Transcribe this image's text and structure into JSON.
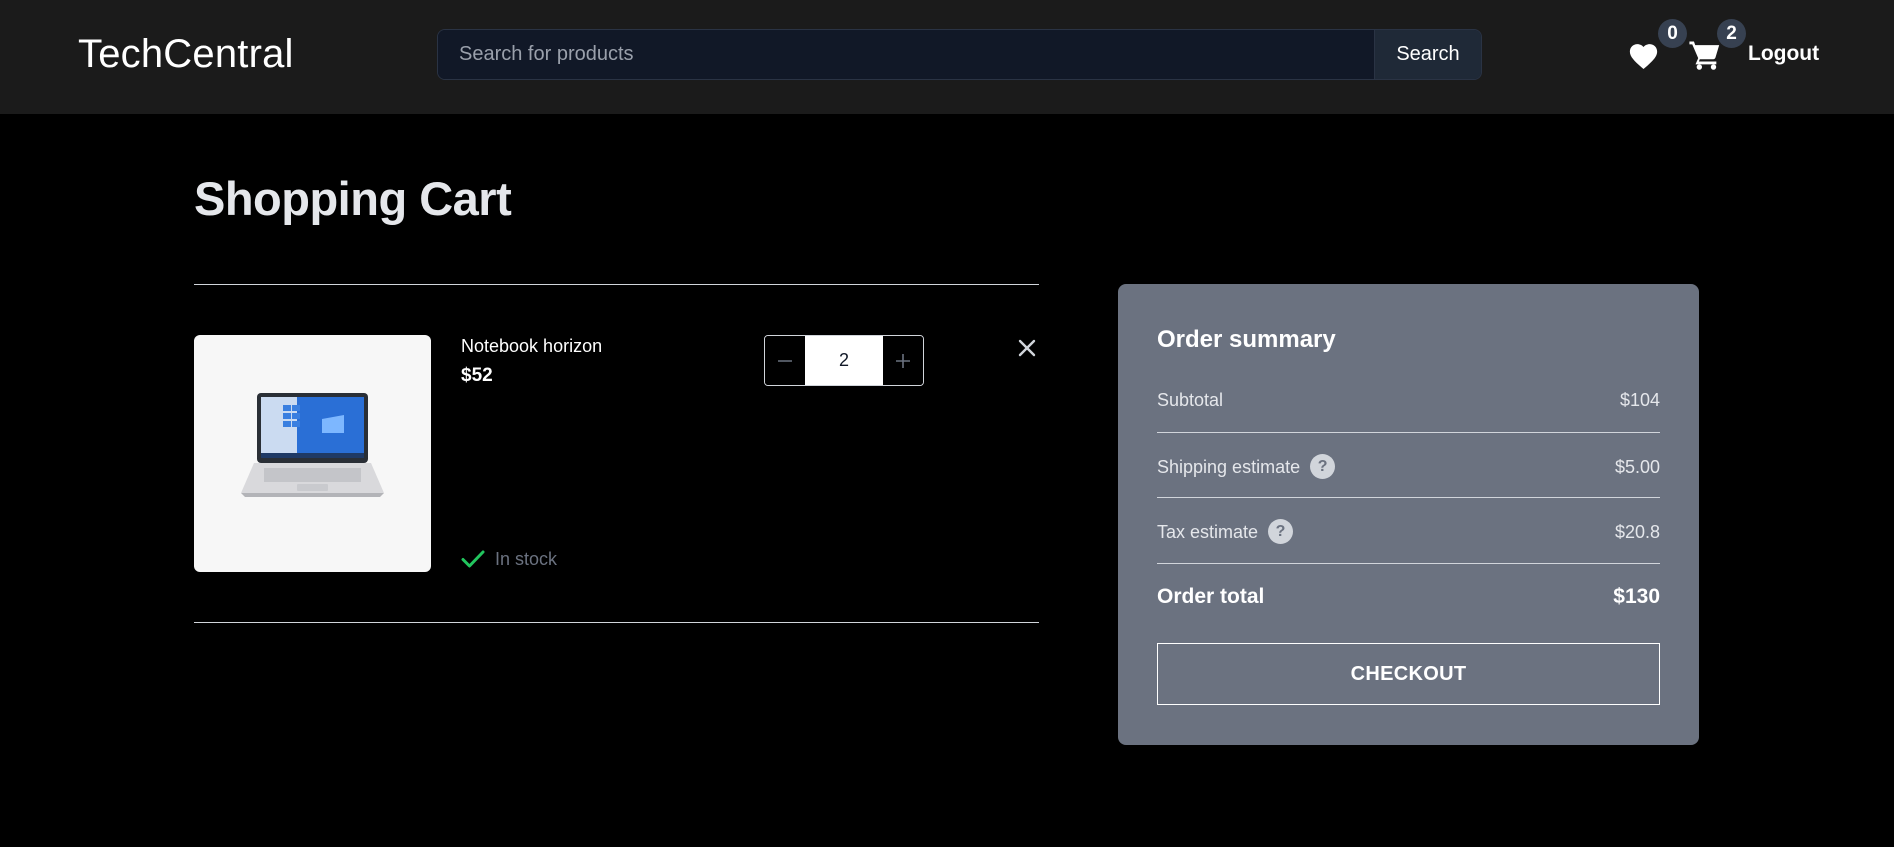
{
  "header": {
    "brand": "TechCentral",
    "search": {
      "placeholder": "Search for products",
      "value": "",
      "button_label": "Search"
    },
    "wishlist_count": "0",
    "cart_count": "2",
    "logout_label": "Logout",
    "icons": [
      "heart-icon",
      "cart-icon"
    ]
  },
  "page": {
    "title": "Shopping Cart"
  },
  "cart": {
    "items": [
      {
        "name": "Notebook horizon",
        "price": "$52",
        "quantity": "2",
        "stock_status": "In stock",
        "image": "laptop"
      }
    ]
  },
  "summary": {
    "title": "Order summary",
    "subtotal_label": "Subtotal",
    "subtotal_value": "$104",
    "shipping_label": "Shipping estimate",
    "shipping_value": "$5.00",
    "tax_label": "Tax estimate",
    "tax_value": "$20.8",
    "total_label": "Order total",
    "total_value": "$130",
    "help_glyph": "?",
    "checkout_label": "CHECKOUT"
  },
  "colors": {
    "header_bg": "#1b1b1b",
    "page_bg": "#000000",
    "summary_bg": "#6b7280",
    "in_stock": "#22c55e",
    "badge_bg": "#374151"
  }
}
